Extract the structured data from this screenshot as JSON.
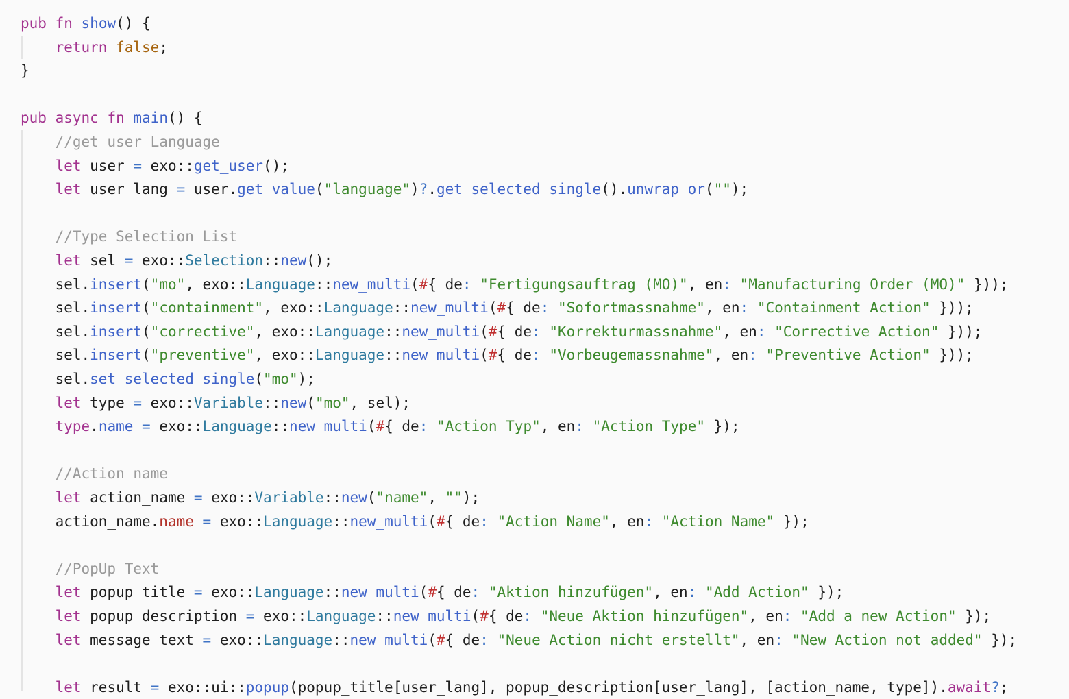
{
  "editor": {
    "lines": [
      [
        {
          "t": "kw",
          "v": "pub"
        },
        {
          "t": "pl",
          "v": " "
        },
        {
          "t": "kw",
          "v": "fn"
        },
        {
          "t": "pl",
          "v": " "
        },
        {
          "t": "fn",
          "v": "show"
        },
        {
          "t": "pl",
          "v": "() {"
        }
      ],
      [
        {
          "t": "pl",
          "v": "    "
        },
        {
          "t": "kw",
          "v": "return"
        },
        {
          "t": "pl",
          "v": " "
        },
        {
          "t": "lit",
          "v": "false"
        },
        {
          "t": "pl",
          "v": ";"
        }
      ],
      [
        {
          "t": "pl",
          "v": "}"
        }
      ],
      [],
      [
        {
          "t": "kw",
          "v": "pub"
        },
        {
          "t": "pl",
          "v": " "
        },
        {
          "t": "kw",
          "v": "async"
        },
        {
          "t": "pl",
          "v": " "
        },
        {
          "t": "kw",
          "v": "fn"
        },
        {
          "t": "pl",
          "v": " "
        },
        {
          "t": "fn",
          "v": "main"
        },
        {
          "t": "pl",
          "v": "() {"
        }
      ],
      [
        {
          "t": "pl",
          "v": "    "
        },
        {
          "t": "cm",
          "v": "//get user Language"
        }
      ],
      [
        {
          "t": "pl",
          "v": "    "
        },
        {
          "t": "kw",
          "v": "let"
        },
        {
          "t": "pl",
          "v": " user "
        },
        {
          "t": "op",
          "v": "="
        },
        {
          "t": "pl",
          "v": " exo::"
        },
        {
          "t": "fn",
          "v": "get_user"
        },
        {
          "t": "pl",
          "v": "();"
        }
      ],
      [
        {
          "t": "pl",
          "v": "    "
        },
        {
          "t": "kw",
          "v": "let"
        },
        {
          "t": "pl",
          "v": " user_lang "
        },
        {
          "t": "op",
          "v": "="
        },
        {
          "t": "pl",
          "v": " user."
        },
        {
          "t": "fn",
          "v": "get_value"
        },
        {
          "t": "pl",
          "v": "("
        },
        {
          "t": "str",
          "v": "\"language\""
        },
        {
          "t": "pl",
          "v": ")"
        },
        {
          "t": "op",
          "v": "?"
        },
        {
          "t": "pl",
          "v": "."
        },
        {
          "t": "fn",
          "v": "get_selected_single"
        },
        {
          "t": "pl",
          "v": "()."
        },
        {
          "t": "fn",
          "v": "unwrap_or"
        },
        {
          "t": "pl",
          "v": "("
        },
        {
          "t": "str",
          "v": "\"\""
        },
        {
          "t": "pl",
          "v": ");"
        }
      ],
      [],
      [
        {
          "t": "pl",
          "v": "    "
        },
        {
          "t": "cm",
          "v": "//Type Selection List"
        }
      ],
      [
        {
          "t": "pl",
          "v": "    "
        },
        {
          "t": "kw",
          "v": "let"
        },
        {
          "t": "pl",
          "v": " sel "
        },
        {
          "t": "op",
          "v": "="
        },
        {
          "t": "pl",
          "v": " exo::"
        },
        {
          "t": "ty",
          "v": "Selection"
        },
        {
          "t": "pl",
          "v": "::"
        },
        {
          "t": "fn",
          "v": "new"
        },
        {
          "t": "pl",
          "v": "();"
        }
      ],
      [
        {
          "t": "pl",
          "v": "    sel."
        },
        {
          "t": "fn",
          "v": "insert"
        },
        {
          "t": "pl",
          "v": "("
        },
        {
          "t": "str",
          "v": "\"mo\""
        },
        {
          "t": "pl",
          "v": ", exo::"
        },
        {
          "t": "ty",
          "v": "Language"
        },
        {
          "t": "pl",
          "v": "::"
        },
        {
          "t": "fn",
          "v": "new_multi"
        },
        {
          "t": "pl",
          "v": "("
        },
        {
          "t": "mac",
          "v": "#"
        },
        {
          "t": "pl",
          "v": "{ de"
        },
        {
          "t": "op",
          "v": ":"
        },
        {
          "t": "pl",
          "v": " "
        },
        {
          "t": "str",
          "v": "\"Fertigungsauftrag (MO)\""
        },
        {
          "t": "pl",
          "v": ", en"
        },
        {
          "t": "op",
          "v": ":"
        },
        {
          "t": "pl",
          "v": " "
        },
        {
          "t": "str",
          "v": "\"Manufacturing Order (MO)\""
        },
        {
          "t": "pl",
          "v": " }));"
        }
      ],
      [
        {
          "t": "pl",
          "v": "    sel."
        },
        {
          "t": "fn",
          "v": "insert"
        },
        {
          "t": "pl",
          "v": "("
        },
        {
          "t": "str",
          "v": "\"containment\""
        },
        {
          "t": "pl",
          "v": ", exo::"
        },
        {
          "t": "ty",
          "v": "Language"
        },
        {
          "t": "pl",
          "v": "::"
        },
        {
          "t": "fn",
          "v": "new_multi"
        },
        {
          "t": "pl",
          "v": "("
        },
        {
          "t": "mac",
          "v": "#"
        },
        {
          "t": "pl",
          "v": "{ de"
        },
        {
          "t": "op",
          "v": ":"
        },
        {
          "t": "pl",
          "v": " "
        },
        {
          "t": "str",
          "v": "\"Sofortmassnahme\""
        },
        {
          "t": "pl",
          "v": ", en"
        },
        {
          "t": "op",
          "v": ":"
        },
        {
          "t": "pl",
          "v": " "
        },
        {
          "t": "str",
          "v": "\"Containment Action\""
        },
        {
          "t": "pl",
          "v": " }));"
        }
      ],
      [
        {
          "t": "pl",
          "v": "    sel."
        },
        {
          "t": "fn",
          "v": "insert"
        },
        {
          "t": "pl",
          "v": "("
        },
        {
          "t": "str",
          "v": "\"corrective\""
        },
        {
          "t": "pl",
          "v": ", exo::"
        },
        {
          "t": "ty",
          "v": "Language"
        },
        {
          "t": "pl",
          "v": "::"
        },
        {
          "t": "fn",
          "v": "new_multi"
        },
        {
          "t": "pl",
          "v": "("
        },
        {
          "t": "mac",
          "v": "#"
        },
        {
          "t": "pl",
          "v": "{ de"
        },
        {
          "t": "op",
          "v": ":"
        },
        {
          "t": "pl",
          "v": " "
        },
        {
          "t": "str",
          "v": "\"Korrekturmassnahme\""
        },
        {
          "t": "pl",
          "v": ", en"
        },
        {
          "t": "op",
          "v": ":"
        },
        {
          "t": "pl",
          "v": " "
        },
        {
          "t": "str",
          "v": "\"Corrective Action\""
        },
        {
          "t": "pl",
          "v": " }));"
        }
      ],
      [
        {
          "t": "pl",
          "v": "    sel."
        },
        {
          "t": "fn",
          "v": "insert"
        },
        {
          "t": "pl",
          "v": "("
        },
        {
          "t": "str",
          "v": "\"preventive\""
        },
        {
          "t": "pl",
          "v": ", exo::"
        },
        {
          "t": "ty",
          "v": "Language"
        },
        {
          "t": "pl",
          "v": "::"
        },
        {
          "t": "fn",
          "v": "new_multi"
        },
        {
          "t": "pl",
          "v": "("
        },
        {
          "t": "mac",
          "v": "#"
        },
        {
          "t": "pl",
          "v": "{ de"
        },
        {
          "t": "op",
          "v": ":"
        },
        {
          "t": "pl",
          "v": " "
        },
        {
          "t": "str",
          "v": "\"Vorbeugemassnahme\""
        },
        {
          "t": "pl",
          "v": ", en"
        },
        {
          "t": "op",
          "v": ":"
        },
        {
          "t": "pl",
          "v": " "
        },
        {
          "t": "str",
          "v": "\"Preventive Action\""
        },
        {
          "t": "pl",
          "v": " }));"
        }
      ],
      [
        {
          "t": "pl",
          "v": "    sel."
        },
        {
          "t": "fn",
          "v": "set_selected_single"
        },
        {
          "t": "pl",
          "v": "("
        },
        {
          "t": "str",
          "v": "\"mo\""
        },
        {
          "t": "pl",
          "v": ");"
        }
      ],
      [
        {
          "t": "pl",
          "v": "    "
        },
        {
          "t": "kw",
          "v": "let"
        },
        {
          "t": "pl",
          "v": " type "
        },
        {
          "t": "op",
          "v": "="
        },
        {
          "t": "pl",
          "v": " exo::"
        },
        {
          "t": "ty",
          "v": "Variable"
        },
        {
          "t": "pl",
          "v": "::"
        },
        {
          "t": "fn",
          "v": "new"
        },
        {
          "t": "pl",
          "v": "("
        },
        {
          "t": "str",
          "v": "\"mo\""
        },
        {
          "t": "pl",
          "v": ", sel);"
        }
      ],
      [
        {
          "t": "pl",
          "v": "    "
        },
        {
          "t": "kw",
          "v": "type"
        },
        {
          "t": "pl",
          "v": "."
        },
        {
          "t": "fn",
          "v": "name"
        },
        {
          "t": "pl",
          "v": " "
        },
        {
          "t": "op",
          "v": "="
        },
        {
          "t": "pl",
          "v": " exo::"
        },
        {
          "t": "ty",
          "v": "Language"
        },
        {
          "t": "pl",
          "v": "::"
        },
        {
          "t": "fn",
          "v": "new_multi"
        },
        {
          "t": "pl",
          "v": "("
        },
        {
          "t": "mac",
          "v": "#"
        },
        {
          "t": "pl",
          "v": "{ de"
        },
        {
          "t": "op",
          "v": ":"
        },
        {
          "t": "pl",
          "v": " "
        },
        {
          "t": "str",
          "v": "\"Action Typ\""
        },
        {
          "t": "pl",
          "v": ", en"
        },
        {
          "t": "op",
          "v": ":"
        },
        {
          "t": "pl",
          "v": " "
        },
        {
          "t": "str",
          "v": "\"Action Type\""
        },
        {
          "t": "pl",
          "v": " });"
        }
      ],
      [],
      [
        {
          "t": "pl",
          "v": "    "
        },
        {
          "t": "cm",
          "v": "//Action name"
        }
      ],
      [
        {
          "t": "pl",
          "v": "    "
        },
        {
          "t": "kw",
          "v": "let"
        },
        {
          "t": "pl",
          "v": " action_name "
        },
        {
          "t": "op",
          "v": "="
        },
        {
          "t": "pl",
          "v": " exo::"
        },
        {
          "t": "ty",
          "v": "Variable"
        },
        {
          "t": "pl",
          "v": "::"
        },
        {
          "t": "fn",
          "v": "new"
        },
        {
          "t": "pl",
          "v": "("
        },
        {
          "t": "str",
          "v": "\"name\""
        },
        {
          "t": "pl",
          "v": ", "
        },
        {
          "t": "str",
          "v": "\"\""
        },
        {
          "t": "pl",
          "v": ");"
        }
      ],
      [
        {
          "t": "pl",
          "v": "    action_name."
        },
        {
          "t": "pr",
          "v": "name"
        },
        {
          "t": "pl",
          "v": " "
        },
        {
          "t": "op",
          "v": "="
        },
        {
          "t": "pl",
          "v": " exo::"
        },
        {
          "t": "ty",
          "v": "Language"
        },
        {
          "t": "pl",
          "v": "::"
        },
        {
          "t": "fn",
          "v": "new_multi"
        },
        {
          "t": "pl",
          "v": "("
        },
        {
          "t": "mac",
          "v": "#"
        },
        {
          "t": "pl",
          "v": "{ de"
        },
        {
          "t": "op",
          "v": ":"
        },
        {
          "t": "pl",
          "v": " "
        },
        {
          "t": "str",
          "v": "\"Action Name\""
        },
        {
          "t": "pl",
          "v": ", en"
        },
        {
          "t": "op",
          "v": ":"
        },
        {
          "t": "pl",
          "v": " "
        },
        {
          "t": "str",
          "v": "\"Action Name\""
        },
        {
          "t": "pl",
          "v": " });"
        }
      ],
      [],
      [
        {
          "t": "pl",
          "v": "    "
        },
        {
          "t": "cm",
          "v": "//PopUp Text"
        }
      ],
      [
        {
          "t": "pl",
          "v": "    "
        },
        {
          "t": "kw",
          "v": "let"
        },
        {
          "t": "pl",
          "v": " popup_title "
        },
        {
          "t": "op",
          "v": "="
        },
        {
          "t": "pl",
          "v": " exo::"
        },
        {
          "t": "ty",
          "v": "Language"
        },
        {
          "t": "pl",
          "v": "::"
        },
        {
          "t": "fn",
          "v": "new_multi"
        },
        {
          "t": "pl",
          "v": "("
        },
        {
          "t": "mac",
          "v": "#"
        },
        {
          "t": "pl",
          "v": "{ de"
        },
        {
          "t": "op",
          "v": ":"
        },
        {
          "t": "pl",
          "v": " "
        },
        {
          "t": "str",
          "v": "\"Aktion hinzufügen\""
        },
        {
          "t": "pl",
          "v": ", en"
        },
        {
          "t": "op",
          "v": ":"
        },
        {
          "t": "pl",
          "v": " "
        },
        {
          "t": "str",
          "v": "\"Add Action\""
        },
        {
          "t": "pl",
          "v": " });"
        }
      ],
      [
        {
          "t": "pl",
          "v": "    "
        },
        {
          "t": "kw",
          "v": "let"
        },
        {
          "t": "pl",
          "v": " popup_description "
        },
        {
          "t": "op",
          "v": "="
        },
        {
          "t": "pl",
          "v": " exo::"
        },
        {
          "t": "ty",
          "v": "Language"
        },
        {
          "t": "pl",
          "v": "::"
        },
        {
          "t": "fn",
          "v": "new_multi"
        },
        {
          "t": "pl",
          "v": "("
        },
        {
          "t": "mac",
          "v": "#"
        },
        {
          "t": "pl",
          "v": "{ de"
        },
        {
          "t": "op",
          "v": ":"
        },
        {
          "t": "pl",
          "v": " "
        },
        {
          "t": "str",
          "v": "\"Neue Aktion hinzufügen\""
        },
        {
          "t": "pl",
          "v": ", en"
        },
        {
          "t": "op",
          "v": ":"
        },
        {
          "t": "pl",
          "v": " "
        },
        {
          "t": "str",
          "v": "\"Add a new Action\""
        },
        {
          "t": "pl",
          "v": " });"
        }
      ],
      [
        {
          "t": "pl",
          "v": "    "
        },
        {
          "t": "kw",
          "v": "let"
        },
        {
          "t": "pl",
          "v": " message_text "
        },
        {
          "t": "op",
          "v": "="
        },
        {
          "t": "pl",
          "v": " exo::"
        },
        {
          "t": "ty",
          "v": "Language"
        },
        {
          "t": "pl",
          "v": "::"
        },
        {
          "t": "fn",
          "v": "new_multi"
        },
        {
          "t": "pl",
          "v": "("
        },
        {
          "t": "mac",
          "v": "#"
        },
        {
          "t": "pl",
          "v": "{ de"
        },
        {
          "t": "op",
          "v": ":"
        },
        {
          "t": "pl",
          "v": " "
        },
        {
          "t": "str",
          "v": "\"Neue Action nicht erstellt\""
        },
        {
          "t": "pl",
          "v": ", en"
        },
        {
          "t": "op",
          "v": ":"
        },
        {
          "t": "pl",
          "v": " "
        },
        {
          "t": "str",
          "v": "\"New Action not added\""
        },
        {
          "t": "pl",
          "v": " });"
        }
      ],
      [],
      [
        {
          "t": "pl",
          "v": "    "
        },
        {
          "t": "kw",
          "v": "let"
        },
        {
          "t": "pl",
          "v": " result "
        },
        {
          "t": "op",
          "v": "="
        },
        {
          "t": "pl",
          "v": " exo::ui::"
        },
        {
          "t": "fn",
          "v": "popup"
        },
        {
          "t": "pl",
          "v": "(popup_title[user_lang], popup_description[user_lang], [action_name, type])."
        },
        {
          "t": "kw",
          "v": "await"
        },
        {
          "t": "op",
          "v": "?"
        },
        {
          "t": "pl",
          "v": ";"
        }
      ]
    ]
  }
}
